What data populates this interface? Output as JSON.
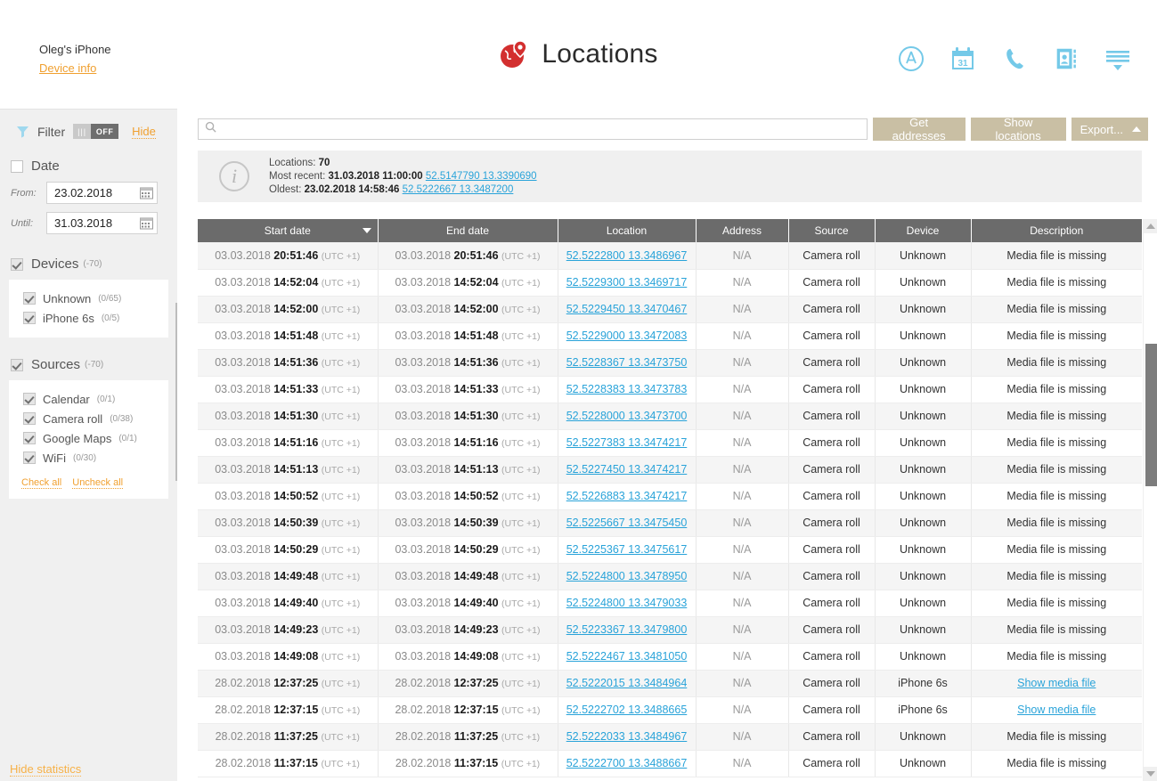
{
  "header": {
    "device_name": "Oleg's iPhone",
    "device_info_link": "Device info",
    "title": "Locations",
    "icons": [
      {
        "name": "appstore-icon"
      },
      {
        "name": "calendar-icon",
        "label": "31"
      },
      {
        "name": "phone-icon"
      },
      {
        "name": "contacts-icon"
      },
      {
        "name": "menu-list-icon"
      }
    ]
  },
  "sidebar": {
    "filter_label": "Filter",
    "toggle_state": "OFF",
    "hide_label": "Hide",
    "date_section": {
      "title": "Date",
      "from_label": "From:",
      "from_value": "23.02.2018",
      "until_label": "Until:",
      "until_value": "31.03.2018"
    },
    "devices_section": {
      "title": "Devices",
      "count": "(-70)",
      "items": [
        {
          "label": "Unknown",
          "count": "(0/65)"
        },
        {
          "label": "iPhone 6s",
          "count": "(0/5)"
        }
      ]
    },
    "sources_section": {
      "title": "Sources",
      "count": "(-70)",
      "items": [
        {
          "label": "Calendar",
          "count": "(0/1)"
        },
        {
          "label": "Camera roll",
          "count": "(0/38)"
        },
        {
          "label": "Google Maps",
          "count": "(0/1)"
        },
        {
          "label": "WiFi",
          "count": "(0/30)"
        }
      ],
      "check_all": "Check all",
      "uncheck_all": "Uncheck all"
    },
    "hide_statistics": "Hide statistics"
  },
  "toolbar": {
    "search_placeholder": "",
    "search_value": "",
    "get_addresses": "Get addresses",
    "show_locations": "Show locations",
    "export": "Export..."
  },
  "info": {
    "locations_label": "Locations:",
    "locations_count": "70",
    "most_recent_label": "Most recent:",
    "most_recent_datetime": "31.03.2018 11:00:00",
    "most_recent_coords": "52.5147790 13.3390690",
    "oldest_label": "Oldest:",
    "oldest_datetime": "23.02.2018 14:58:46",
    "oldest_coords": "52.5222667 13.3487200"
  },
  "table": {
    "columns": [
      "Start date",
      "End date",
      "Location",
      "Address",
      "Source",
      "Device",
      "Description"
    ],
    "sorted_column": "Start date",
    "rows": [
      {
        "date": "03.03.2018",
        "time": "20:51:46",
        "tz": "(UTC +1)",
        "end_date": "03.03.2018",
        "end_time": "20:51:46",
        "end_tz": "(UTC +1)",
        "location": "52.5222800 13.3486967",
        "address": "N/A",
        "source": "Camera roll",
        "device": "Unknown",
        "description": "Media file is missing",
        "desc_is_link": false
      },
      {
        "date": "03.03.2018",
        "time": "14:52:04",
        "tz": "(UTC +1)",
        "end_date": "03.03.2018",
        "end_time": "14:52:04",
        "end_tz": "(UTC +1)",
        "location": "52.5229300 13.3469717",
        "address": "N/A",
        "source": "Camera roll",
        "device": "Unknown",
        "description": "Media file is missing",
        "desc_is_link": false
      },
      {
        "date": "03.03.2018",
        "time": "14:52:00",
        "tz": "(UTC +1)",
        "end_date": "03.03.2018",
        "end_time": "14:52:00",
        "end_tz": "(UTC +1)",
        "location": "52.5229450 13.3470467",
        "address": "N/A",
        "source": "Camera roll",
        "device": "Unknown",
        "description": "Media file is missing",
        "desc_is_link": false
      },
      {
        "date": "03.03.2018",
        "time": "14:51:48",
        "tz": "(UTC +1)",
        "end_date": "03.03.2018",
        "end_time": "14:51:48",
        "end_tz": "(UTC +1)",
        "location": "52.5229000 13.3472083",
        "address": "N/A",
        "source": "Camera roll",
        "device": "Unknown",
        "description": "Media file is missing",
        "desc_is_link": false
      },
      {
        "date": "03.03.2018",
        "time": "14:51:36",
        "tz": "(UTC +1)",
        "end_date": "03.03.2018",
        "end_time": "14:51:36",
        "end_tz": "(UTC +1)",
        "location": "52.5228367 13.3473750",
        "address": "N/A",
        "source": "Camera roll",
        "device": "Unknown",
        "description": "Media file is missing",
        "desc_is_link": false
      },
      {
        "date": "03.03.2018",
        "time": "14:51:33",
        "tz": "(UTC +1)",
        "end_date": "03.03.2018",
        "end_time": "14:51:33",
        "end_tz": "(UTC +1)",
        "location": "52.5228383 13.3473783",
        "address": "N/A",
        "source": "Camera roll",
        "device": "Unknown",
        "description": "Media file is missing",
        "desc_is_link": false
      },
      {
        "date": "03.03.2018",
        "time": "14:51:30",
        "tz": "(UTC +1)",
        "end_date": "03.03.2018",
        "end_time": "14:51:30",
        "end_tz": "(UTC +1)",
        "location": "52.5228000 13.3473700",
        "address": "N/A",
        "source": "Camera roll",
        "device": "Unknown",
        "description": "Media file is missing",
        "desc_is_link": false
      },
      {
        "date": "03.03.2018",
        "time": "14:51:16",
        "tz": "(UTC +1)",
        "end_date": "03.03.2018",
        "end_time": "14:51:16",
        "end_tz": "(UTC +1)",
        "location": "52.5227383 13.3474217",
        "address": "N/A",
        "source": "Camera roll",
        "device": "Unknown",
        "description": "Media file is missing",
        "desc_is_link": false
      },
      {
        "date": "03.03.2018",
        "time": "14:51:13",
        "tz": "(UTC +1)",
        "end_date": "03.03.2018",
        "end_time": "14:51:13",
        "end_tz": "(UTC +1)",
        "location": "52.5227450 13.3474217",
        "address": "N/A",
        "source": "Camera roll",
        "device": "Unknown",
        "description": "Media file is missing",
        "desc_is_link": false
      },
      {
        "date": "03.03.2018",
        "time": "14:50:52",
        "tz": "(UTC +1)",
        "end_date": "03.03.2018",
        "end_time": "14:50:52",
        "end_tz": "(UTC +1)",
        "location": "52.5226883 13.3474217",
        "address": "N/A",
        "source": "Camera roll",
        "device": "Unknown",
        "description": "Media file is missing",
        "desc_is_link": false
      },
      {
        "date": "03.03.2018",
        "time": "14:50:39",
        "tz": "(UTC +1)",
        "end_date": "03.03.2018",
        "end_time": "14:50:39",
        "end_tz": "(UTC +1)",
        "location": "52.5225667 13.3475450",
        "address": "N/A",
        "source": "Camera roll",
        "device": "Unknown",
        "description": "Media file is missing",
        "desc_is_link": false
      },
      {
        "date": "03.03.2018",
        "time": "14:50:29",
        "tz": "(UTC +1)",
        "end_date": "03.03.2018",
        "end_time": "14:50:29",
        "end_tz": "(UTC +1)",
        "location": "52.5225367 13.3475617",
        "address": "N/A",
        "source": "Camera roll",
        "device": "Unknown",
        "description": "Media file is missing",
        "desc_is_link": false
      },
      {
        "date": "03.03.2018",
        "time": "14:49:48",
        "tz": "(UTC +1)",
        "end_date": "03.03.2018",
        "end_time": "14:49:48",
        "end_tz": "(UTC +1)",
        "location": "52.5224800 13.3478950",
        "address": "N/A",
        "source": "Camera roll",
        "device": "Unknown",
        "description": "Media file is missing",
        "desc_is_link": false
      },
      {
        "date": "03.03.2018",
        "time": "14:49:40",
        "tz": "(UTC +1)",
        "end_date": "03.03.2018",
        "end_time": "14:49:40",
        "end_tz": "(UTC +1)",
        "location": "52.5224800 13.3479033",
        "address": "N/A",
        "source": "Camera roll",
        "device": "Unknown",
        "description": "Media file is missing",
        "desc_is_link": false
      },
      {
        "date": "03.03.2018",
        "time": "14:49:23",
        "tz": "(UTC +1)",
        "end_date": "03.03.2018",
        "end_time": "14:49:23",
        "end_tz": "(UTC +1)",
        "location": "52.5223367 13.3479800",
        "address": "N/A",
        "source": "Camera roll",
        "device": "Unknown",
        "description": "Media file is missing",
        "desc_is_link": false
      },
      {
        "date": "03.03.2018",
        "time": "14:49:08",
        "tz": "(UTC +1)",
        "end_date": "03.03.2018",
        "end_time": "14:49:08",
        "end_tz": "(UTC +1)",
        "location": "52.5222467 13.3481050",
        "address": "N/A",
        "source": "Camera roll",
        "device": "Unknown",
        "description": "Media file is missing",
        "desc_is_link": false
      },
      {
        "date": "28.02.2018",
        "time": "12:37:25",
        "tz": "(UTC +1)",
        "end_date": "28.02.2018",
        "end_time": "12:37:25",
        "end_tz": "(UTC +1)",
        "location": "52.5222015 13.3484964",
        "address": "N/A",
        "source": "Camera roll",
        "device": "iPhone 6s",
        "description": "Show media file",
        "desc_is_link": true
      },
      {
        "date": "28.02.2018",
        "time": "12:37:15",
        "tz": "(UTC +1)",
        "end_date": "28.02.2018",
        "end_time": "12:37:15",
        "end_tz": "(UTC +1)",
        "location": "52.5222702 13.3488665",
        "address": "N/A",
        "source": "Camera roll",
        "device": "iPhone 6s",
        "description": "Show media file",
        "desc_is_link": true
      },
      {
        "date": "28.02.2018",
        "time": "11:37:25",
        "tz": "(UTC +1)",
        "end_date": "28.02.2018",
        "end_time": "11:37:25",
        "end_tz": "(UTC +1)",
        "location": "52.5222033 13.3484967",
        "address": "N/A",
        "source": "Camera roll",
        "device": "Unknown",
        "description": "Media file is missing",
        "desc_is_link": false
      },
      {
        "date": "28.02.2018",
        "time": "11:37:15",
        "tz": "(UTC +1)",
        "end_date": "28.02.2018",
        "end_time": "11:37:15",
        "end_tz": "(UTC +1)",
        "location": "52.5222700 13.3488667",
        "address": "N/A",
        "source": "Camera roll",
        "device": "Unknown",
        "description": "Media file is missing",
        "desc_is_link": false
      }
    ]
  },
  "colors": {
    "accent_orange": "#f0a030",
    "link_blue": "#29a3d9",
    "icon_blue": "#74c9e8",
    "button_tan": "#c9bfa4",
    "header_gray": "#6b6b6b",
    "logo_red": "#d32f2f"
  }
}
